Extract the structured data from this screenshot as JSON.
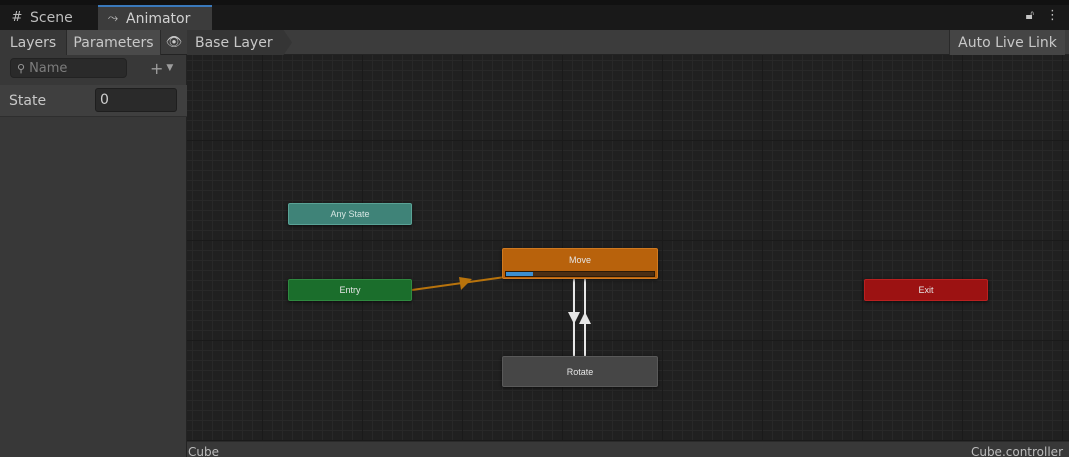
{
  "tabs": [
    {
      "label": "Scene",
      "icon": "grid-icon"
    },
    {
      "label": "Animator",
      "icon": "animator-icon"
    }
  ],
  "window_icons": [
    "lock-icon",
    "kebab-menu-icon"
  ],
  "toolbar": {
    "layers_label": "Layers",
    "parameters_label": "Parameters",
    "eye_icon": "eye-icon",
    "breadcrumb": "Base Layer",
    "auto_live_link_label": "Auto Live Link"
  },
  "sidebar": {
    "search_placeholder": "Name",
    "parameters": [
      {
        "name": "State",
        "value": "0"
      }
    ]
  },
  "graph": {
    "nodes": {
      "any_state": "Any State",
      "entry": "Entry",
      "move": "Move",
      "rotate": "Rotate",
      "exit": "Exit"
    },
    "move_progress": 0.18,
    "colors": {
      "any_state": "#3f8378",
      "entry": "#1b6e2c",
      "move": "#b8620c",
      "rotate": "#464646",
      "exit": "#9c1212",
      "default_transition": "#b8730c",
      "transition": "#e6e6e6",
      "progress": "#3d8fd0"
    }
  },
  "status": {
    "left": "Cube",
    "right": "Cube.controller"
  }
}
